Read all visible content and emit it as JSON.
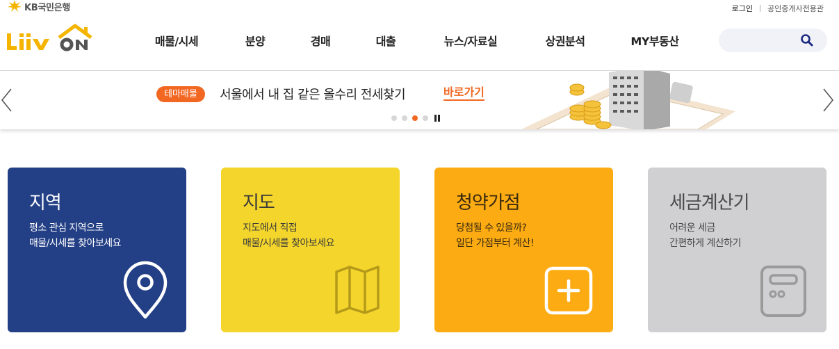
{
  "header": {
    "bank_name": "KB국민은행",
    "logo_text": "Liiv ON",
    "util_links": {
      "login": "로그인",
      "agent": "공인중개사전용관"
    },
    "nav": [
      "매물/시세",
      "분양",
      "경매",
      "대출",
      "뉴스/자료실",
      "상권분석",
      "MY부동산"
    ],
    "search": {
      "placeholder": "",
      "icon": "search-icon"
    }
  },
  "banner": {
    "badge": "테마매물",
    "title": "서울에서 내 집 같은 올수리 전세찾기",
    "link": "바로가기",
    "slides": 4,
    "active_slide": 3
  },
  "cards": [
    {
      "title": "지역",
      "desc": [
        "평소 관심 지역으로",
        "매물/시세를 찾아보세요"
      ],
      "icon": "location-pin-icon",
      "color": "#233f85"
    },
    {
      "title": "지도",
      "desc": [
        "지도에서 직접",
        "매물/시세를 찾아보세요"
      ],
      "icon": "folded-map-icon",
      "color": "#f4d52b"
    },
    {
      "title": "청약가점",
      "desc": [
        "당첨될 수 있을까?",
        "일단 가점부터 계산!"
      ],
      "icon": "plus-square-icon",
      "color": "#fcab12"
    },
    {
      "title": "세금계산기",
      "desc": [
        "어려운 세금",
        "간편하게 계산하기"
      ],
      "icon": "calculator-icon",
      "color": "#d0cfd1"
    }
  ],
  "colors": {
    "accent": "#f26722",
    "brand_yellow": "#f4b400",
    "nav_text": "#222222",
    "search_icon": "#1b2a80"
  }
}
